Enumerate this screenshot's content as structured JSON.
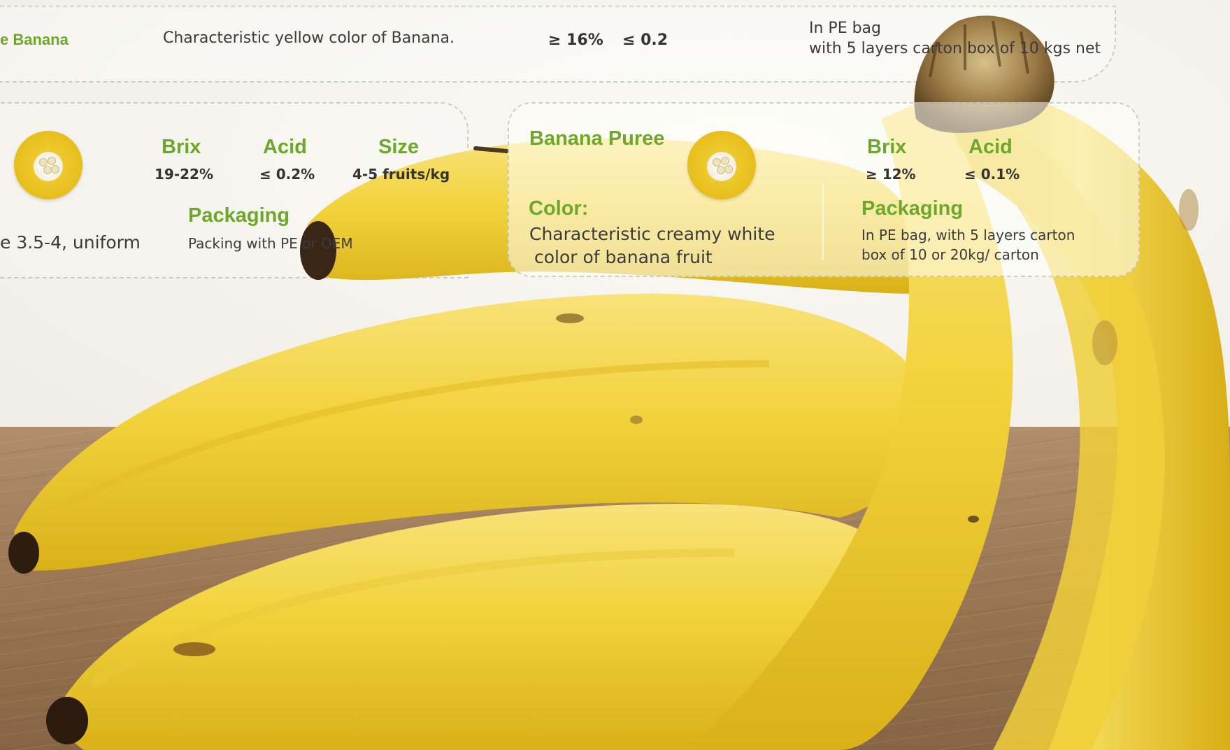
{
  "top_row": {
    "product_name": "e Banana",
    "color_text": "Characteristic yellow color of Banana.",
    "brix_value": "≥ 16%",
    "acid_value": "≤ 0.2",
    "packaging_line1": "In PE bag",
    "packaging_line2": "with 5 layers carton box of 10 kgs net"
  },
  "left_card": {
    "brix_label": "Brix",
    "brix_value": "19-22%",
    "acid_label": "Acid",
    "acid_value": "≤ 0.2%",
    "size_label": "Size",
    "size_value": "4-5 fruits/kg",
    "packaging_label": "Packaging",
    "packaging_text": "Packing with PE or OEM",
    "ratio_text": "e 3.5-4, uniform"
  },
  "right_card": {
    "title": "Banana Puree",
    "brix_label": "Brix",
    "brix_value": "≥ 12%",
    "acid_label": "Acid",
    "acid_value": "≤ 0.1%",
    "color_label": "Color:",
    "color_line1": "Characteristic creamy white",
    "color_line2": "color of banana fruit",
    "packaging_label": "Packaging",
    "packaging_line1": "In PE bag, with 5 layers carton",
    "packaging_line2": "box of 10 or 20kg/ carton"
  },
  "colors": {
    "accent_green": "#6ea82a",
    "banana_yellow": "#f2d23b",
    "text_dark": "#3a3a3a"
  },
  "icons": {
    "product_thumb": "banana-puree-bowl-icon"
  }
}
